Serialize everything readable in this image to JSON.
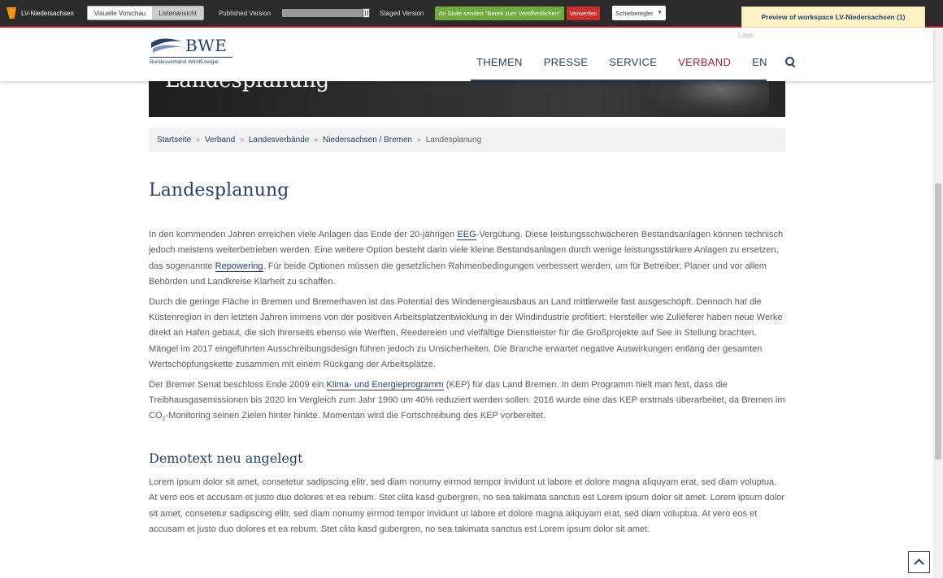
{
  "workspace_bar": {
    "workspace_name": "LV-Niedersachsen",
    "view_modes": [
      "Visuelle Vorschau",
      "Listenansicht"
    ],
    "published_label": "Published Version",
    "staged_label": "Staged Version",
    "slider_position": 1.0,
    "stage_button": "An Stufe senden \"Bereit zum Veröffentlichen\"",
    "discard_button": "Verwerfen",
    "mode_select": "Schieberegler",
    "accent_green": "#6fab3f",
    "accent_red": "#c9302c"
  },
  "header": {
    "logo_text": "BWE",
    "logo_subtitle": "Bundesverband WindEnergie",
    "login": "Login",
    "nav": [
      {
        "label": "THEMEN"
      },
      {
        "label": "PRESSE"
      },
      {
        "label": "SERVICE"
      },
      {
        "label": "VERBAND"
      },
      {
        "label": "EN"
      }
    ],
    "search_icon": "search-icon",
    "brand_color": "#26416d",
    "active_color": "#b01c2e"
  },
  "preview_badge": "Preview of workspace LV-Niedersachsen (1)",
  "hero": {
    "title": "Landesplanung"
  },
  "breadcrumb": {
    "items": [
      "Startseite",
      "Verband",
      "Landesverbände",
      "Niedersachsen / Bremen"
    ],
    "current": "Landesplanung"
  },
  "content": {
    "title": "Landesplanung",
    "p1": {
      "t1": "In den kommenden Jahren erreichen viele Anlagen das Ende der 20-jährigen ",
      "link1": "EEG",
      "t2": "-Vergütung. Diese leistungsschwächeren Bestandsanlagen können technisch jedoch meistens weiterbetrieben werden. Eine weitere Option besteht darin viele kleine Bestandsanlagen durch wenige leistungsstärkere Anlagen zu ersetzen, das sogenannte ",
      "link2": "Repowering",
      "t3": ". Für beide Optionen müssen die gesetzlichen Rahmenbedingungen verbessert werden, um für Betreiber, Planer und vor allem Behörden und Landkreise Klarheit zu schaffen."
    },
    "p2": "Durch die geringe Fläche in Bremen und Bremerhaven ist das Potential des Windenergieausbaus an Land mittlerweile fast ausgeschöpft. Dennoch hat die Küstenregion in den letzten Jahren immens von der positiven Arbeitsplatzentwicklung in der Windindustrie profitiert: Hersteller wie Zulieferer haben neue Werke direkt an Hafen gebaut, die sich ihrerseits ebenso wie Werften, Reedereien und vielfältige Dienstleister für die Großprojekte auf See in Stellung brachten. Mängel im 2017 eingeführten Ausschreibungsdesign führen jedoch zu Unsicherheiten. Die Branche erwartet negative Auswirkungen entlang der gesamten Wertschöpfungskette zusammen mit einem Rückgang der Arbeitsplätze.",
    "p3": {
      "t1": "Der Bremer Senat beschloss Ende 2009 ein ",
      "link": "Klima- und Energieprogramm",
      "t2": " (KEP) für das Land Bremen. In dem Programm hielt man fest, dass die Treibhausgasemissionen bis 2020 im Vergleich zum Jahr 1990 um 40% reduziert werden sollen. 2016 wurde eine das KEP erstmals überarbeitet, da Bremen im CO",
      "sub": "2",
      "t3": "-Monitoring seinen Zielen hinter hinkte. Momentan wird die Fortschreibung des KEP vorbereitet."
    },
    "subheading": "Demotext neu angelegt",
    "p4": "Lorem ipsum dolor sit amet, consetetur sadipscing elitr, sed diam nonumy eirmod tempor invidunt ut labore et dolore magna aliquyam erat, sed diam voluptua. At vero eos et accusam et justo duo dolores et ea rebum. Stet clita kasd gubergren, no sea takimata sanctus est Lorem ipsum dolor sit amet. Lorem ipsum dolor sit amet, consetetur sadipscing elitr, sed diam nonumy eirmod tempor invidunt ut labore et dolore magna aliquyam erat, sed diam voluptua. At vero eos et accusam et justo duo dolores et ea rebum. Stet clita kasd gubergren, no sea takimata sanctus est Lorem ipsum dolor sit amet."
  },
  "back_to_top_icon": "chevron-up-icon"
}
